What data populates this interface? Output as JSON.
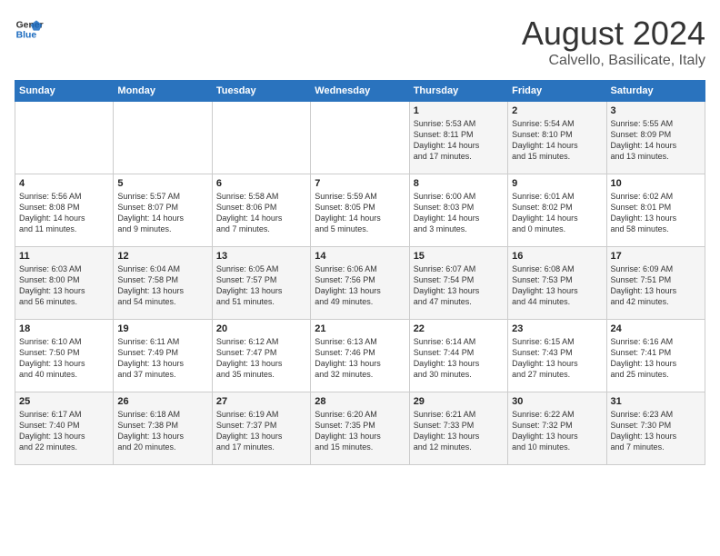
{
  "logo": {
    "line1": "General",
    "line2": "Blue"
  },
  "title": "August 2024",
  "subtitle": "Calvello, Basilicate, Italy",
  "days_of_week": [
    "Sunday",
    "Monday",
    "Tuesday",
    "Wednesday",
    "Thursday",
    "Friday",
    "Saturday"
  ],
  "weeks": [
    [
      {
        "day": "",
        "content": ""
      },
      {
        "day": "",
        "content": ""
      },
      {
        "day": "",
        "content": ""
      },
      {
        "day": "",
        "content": ""
      },
      {
        "day": "1",
        "content": "Sunrise: 5:53 AM\nSunset: 8:11 PM\nDaylight: 14 hours\nand 17 minutes."
      },
      {
        "day": "2",
        "content": "Sunrise: 5:54 AM\nSunset: 8:10 PM\nDaylight: 14 hours\nand 15 minutes."
      },
      {
        "day": "3",
        "content": "Sunrise: 5:55 AM\nSunset: 8:09 PM\nDaylight: 14 hours\nand 13 minutes."
      }
    ],
    [
      {
        "day": "4",
        "content": "Sunrise: 5:56 AM\nSunset: 8:08 PM\nDaylight: 14 hours\nand 11 minutes."
      },
      {
        "day": "5",
        "content": "Sunrise: 5:57 AM\nSunset: 8:07 PM\nDaylight: 14 hours\nand 9 minutes."
      },
      {
        "day": "6",
        "content": "Sunrise: 5:58 AM\nSunset: 8:06 PM\nDaylight: 14 hours\nand 7 minutes."
      },
      {
        "day": "7",
        "content": "Sunrise: 5:59 AM\nSunset: 8:05 PM\nDaylight: 14 hours\nand 5 minutes."
      },
      {
        "day": "8",
        "content": "Sunrise: 6:00 AM\nSunset: 8:03 PM\nDaylight: 14 hours\nand 3 minutes."
      },
      {
        "day": "9",
        "content": "Sunrise: 6:01 AM\nSunset: 8:02 PM\nDaylight: 14 hours\nand 0 minutes."
      },
      {
        "day": "10",
        "content": "Sunrise: 6:02 AM\nSunset: 8:01 PM\nDaylight: 13 hours\nand 58 minutes."
      }
    ],
    [
      {
        "day": "11",
        "content": "Sunrise: 6:03 AM\nSunset: 8:00 PM\nDaylight: 13 hours\nand 56 minutes."
      },
      {
        "day": "12",
        "content": "Sunrise: 6:04 AM\nSunset: 7:58 PM\nDaylight: 13 hours\nand 54 minutes."
      },
      {
        "day": "13",
        "content": "Sunrise: 6:05 AM\nSunset: 7:57 PM\nDaylight: 13 hours\nand 51 minutes."
      },
      {
        "day": "14",
        "content": "Sunrise: 6:06 AM\nSunset: 7:56 PM\nDaylight: 13 hours\nand 49 minutes."
      },
      {
        "day": "15",
        "content": "Sunrise: 6:07 AM\nSunset: 7:54 PM\nDaylight: 13 hours\nand 47 minutes."
      },
      {
        "day": "16",
        "content": "Sunrise: 6:08 AM\nSunset: 7:53 PM\nDaylight: 13 hours\nand 44 minutes."
      },
      {
        "day": "17",
        "content": "Sunrise: 6:09 AM\nSunset: 7:51 PM\nDaylight: 13 hours\nand 42 minutes."
      }
    ],
    [
      {
        "day": "18",
        "content": "Sunrise: 6:10 AM\nSunset: 7:50 PM\nDaylight: 13 hours\nand 40 minutes."
      },
      {
        "day": "19",
        "content": "Sunrise: 6:11 AM\nSunset: 7:49 PM\nDaylight: 13 hours\nand 37 minutes."
      },
      {
        "day": "20",
        "content": "Sunrise: 6:12 AM\nSunset: 7:47 PM\nDaylight: 13 hours\nand 35 minutes."
      },
      {
        "day": "21",
        "content": "Sunrise: 6:13 AM\nSunset: 7:46 PM\nDaylight: 13 hours\nand 32 minutes."
      },
      {
        "day": "22",
        "content": "Sunrise: 6:14 AM\nSunset: 7:44 PM\nDaylight: 13 hours\nand 30 minutes."
      },
      {
        "day": "23",
        "content": "Sunrise: 6:15 AM\nSunset: 7:43 PM\nDaylight: 13 hours\nand 27 minutes."
      },
      {
        "day": "24",
        "content": "Sunrise: 6:16 AM\nSunset: 7:41 PM\nDaylight: 13 hours\nand 25 minutes."
      }
    ],
    [
      {
        "day": "25",
        "content": "Sunrise: 6:17 AM\nSunset: 7:40 PM\nDaylight: 13 hours\nand 22 minutes."
      },
      {
        "day": "26",
        "content": "Sunrise: 6:18 AM\nSunset: 7:38 PM\nDaylight: 13 hours\nand 20 minutes."
      },
      {
        "day": "27",
        "content": "Sunrise: 6:19 AM\nSunset: 7:37 PM\nDaylight: 13 hours\nand 17 minutes."
      },
      {
        "day": "28",
        "content": "Sunrise: 6:20 AM\nSunset: 7:35 PM\nDaylight: 13 hours\nand 15 minutes."
      },
      {
        "day": "29",
        "content": "Sunrise: 6:21 AM\nSunset: 7:33 PM\nDaylight: 13 hours\nand 12 minutes."
      },
      {
        "day": "30",
        "content": "Sunrise: 6:22 AM\nSunset: 7:32 PM\nDaylight: 13 hours\nand 10 minutes."
      },
      {
        "day": "31",
        "content": "Sunrise: 6:23 AM\nSunset: 7:30 PM\nDaylight: 13 hours\nand 7 minutes."
      }
    ]
  ]
}
